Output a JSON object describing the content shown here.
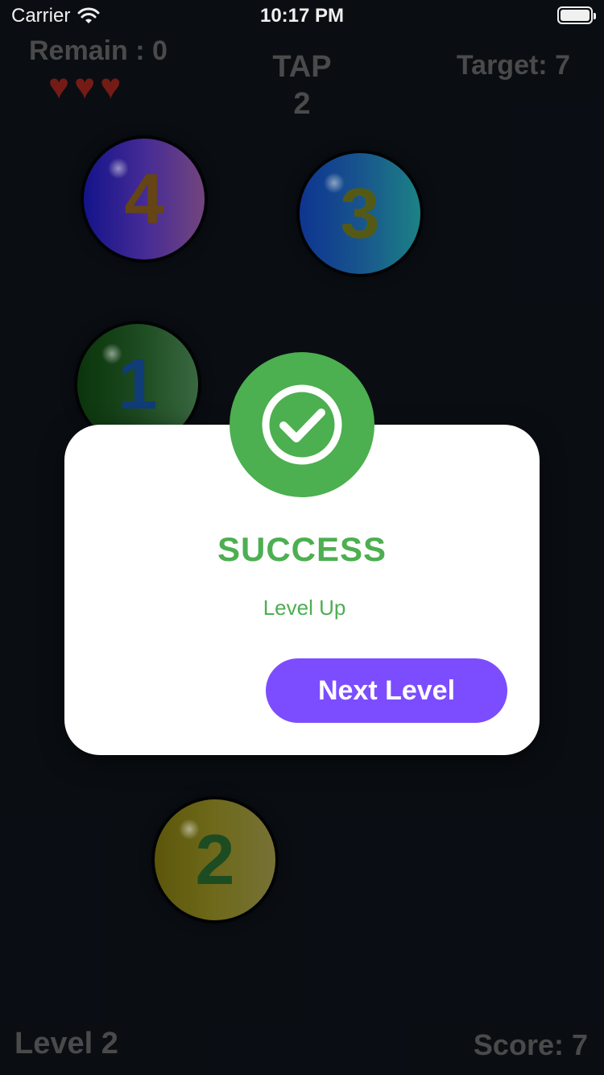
{
  "status_bar": {
    "carrier": "Carrier",
    "time": "10:17 PM",
    "wifi_icon": "wifi-icon",
    "battery_icon": "battery-full-icon"
  },
  "hud": {
    "remain": "Remain : 0",
    "hearts": [
      "♥",
      "♥",
      "♥"
    ],
    "tap_label": "TAP",
    "tap_value": "2",
    "target": "Target: 7",
    "level": "Level 2",
    "score": "Score: 7"
  },
  "balls": [
    {
      "number": "4"
    },
    {
      "number": "3"
    },
    {
      "number": "1"
    },
    {
      "number": "2"
    }
  ],
  "modal": {
    "icon": "check-circle-icon",
    "title": "SUCCESS",
    "subtitle": "Level Up",
    "button_label": "Next Level"
  },
  "colors": {
    "background": "#0b0f15",
    "success_green": "#4caf50",
    "button_purple": "#7c4dff",
    "heart_red": "#7d1d17"
  }
}
